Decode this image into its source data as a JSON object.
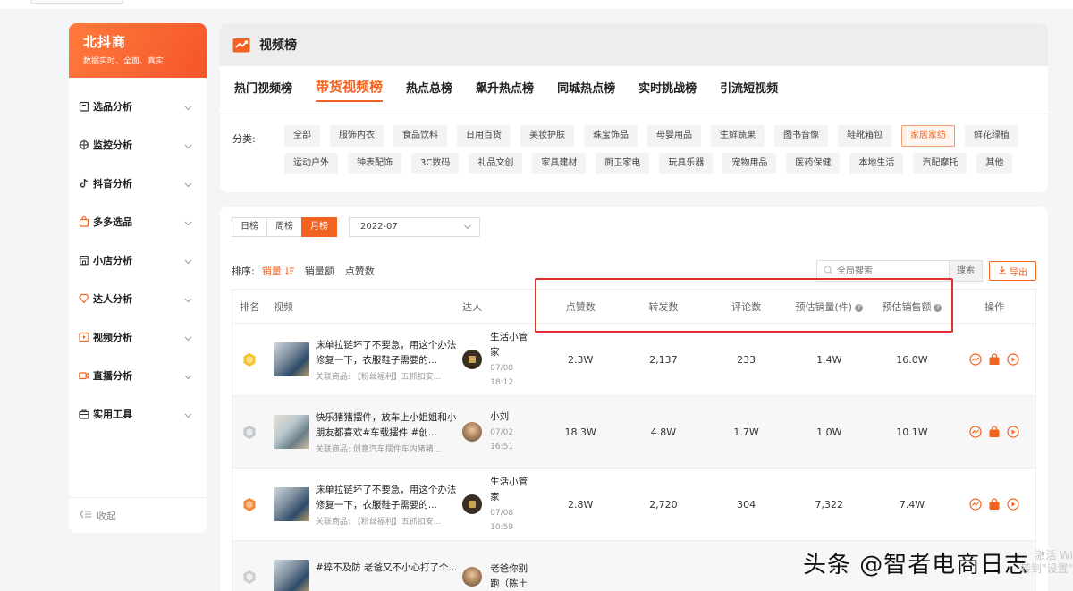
{
  "sidebar": {
    "brand": {
      "name": "北抖商",
      "slogan": "数据实时、全面、真实"
    },
    "items": [
      {
        "label": "选品分析",
        "icon": "clipboard-icon"
      },
      {
        "label": "监控分析",
        "icon": "crosshair-icon"
      },
      {
        "label": "抖音分析",
        "icon": "tiktok-icon"
      },
      {
        "label": "多多选品",
        "icon": "shopping-bag-icon"
      },
      {
        "label": "小店分析",
        "icon": "store-icon"
      },
      {
        "label": "达人分析",
        "icon": "diamond-icon"
      },
      {
        "label": "视频分析",
        "icon": "video-icon"
      },
      {
        "label": "直播分析",
        "icon": "camera-icon"
      },
      {
        "label": "实用工具",
        "icon": "toolbox-icon"
      }
    ],
    "collapse_label": "收起"
  },
  "header": {
    "title": "视频榜",
    "tabs": [
      {
        "label": "热门视频榜",
        "active": false
      },
      {
        "label": "带货视频榜",
        "active": true
      },
      {
        "label": "热点总榜",
        "active": false
      },
      {
        "label": "飙升热点榜",
        "active": false
      },
      {
        "label": "同城热点榜",
        "active": false
      },
      {
        "label": "实时挑战榜",
        "active": false
      },
      {
        "label": "引流短视频",
        "active": false
      }
    ],
    "category_label": "分类:",
    "categories_row1": [
      "全部",
      "服饰内衣",
      "食品饮料",
      "日用百货",
      "美妆护肤",
      "珠宝饰品",
      "母婴用品",
      "生鲜蔬果",
      "图书音像",
      "鞋靴箱包",
      "家居家纺",
      "鲜花绿植"
    ],
    "categories_row2": [
      "运动户外",
      "钟表配饰",
      "3C数码",
      "礼品文创",
      "家具建材",
      "厨卫家电",
      "玩具乐器",
      "宠物用品",
      "医药保健",
      "本地生活",
      "汽配摩托",
      "其他"
    ],
    "active_category": "家居家纺"
  },
  "filters": {
    "periods": [
      "日榜",
      "周榜",
      "月榜"
    ],
    "active_period": "月榜",
    "month": "2022-07",
    "sort_label": "排序:",
    "sort_options": [
      "销量",
      "销量额",
      "点赞数"
    ],
    "active_sort": "销量",
    "search_placeholder": "全局搜索",
    "search_button": "搜索",
    "export_label": "导出"
  },
  "table": {
    "headers": {
      "rank": "排名",
      "video": "视频",
      "talent": "达人",
      "likes": "点赞数",
      "shares": "转发数",
      "comments": "评论数",
      "est_sales": "预估销量(件)",
      "est_revenue": "预估销售额",
      "actions": "操作"
    },
    "rows": [
      {
        "rank": 1,
        "video_title": "床单拉链坏了不要急，用这个办法修复一下，衣服鞋子需要的...",
        "product": "关联商品: 【粉丝福利】五抓扣安...",
        "talent_name": "生活小管家",
        "talent_date": "07/08 18:12",
        "likes": "2.3W",
        "shares": "2,137",
        "comments": "233",
        "est_sales": "1.4W",
        "est_revenue": "16.0W"
      },
      {
        "rank": 2,
        "video_title": "快乐猪猪摆件，放车上小姐姐和小朋友都喜欢#车载摆件 #创...",
        "product": "关联商品: 创意汽车摆件车内猪猪...",
        "talent_name": "小刘",
        "talent_date": "07/02 16:51",
        "likes": "18.3W",
        "shares": "4.8W",
        "comments": "1.7W",
        "est_sales": "1.0W",
        "est_revenue": "10.1W"
      },
      {
        "rank": 3,
        "video_title": "床单拉链坏了不要急，用这个办法修复一下，衣服鞋子需要的...",
        "product": "关联商品: 【粉丝福利】五抓扣安...",
        "talent_name": "生活小管家",
        "talent_date": "07/08 10:59",
        "likes": "2.8W",
        "shares": "2,720",
        "comments": "304",
        "est_sales": "7,322",
        "est_revenue": "7.4W"
      },
      {
        "rank": 4,
        "video_title": "#猝不及防 老爸又不小心打了个...",
        "product": "",
        "talent_name": "老爸你别跑（陈土",
        "talent_date": "",
        "likes": "",
        "shares": "",
        "comments": "",
        "est_sales": "",
        "est_revenue": ""
      }
    ]
  },
  "watermark": "头条 @智者电商日志",
  "os_watermark": "激活 Wi\n转到\"设置\"",
  "colors": {
    "accent": "#f26322",
    "highlight": "#e62e2e"
  }
}
